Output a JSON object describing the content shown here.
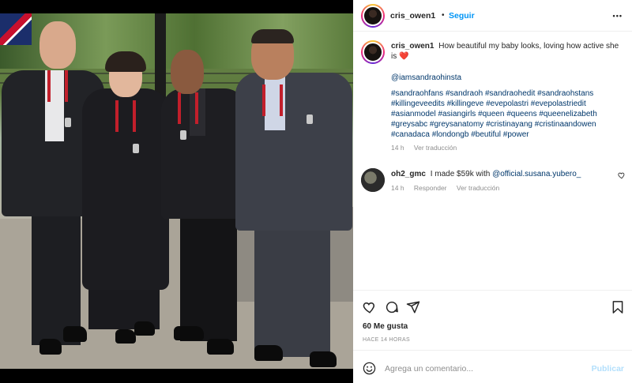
{
  "post": {
    "author": "cris_owen1",
    "separator": "•",
    "follow_label": "Seguir",
    "more_label": "•••"
  },
  "caption": {
    "author": "cris_owen1",
    "text": "How beautiful my baby looks, loving how active she is",
    "emoji": "❤️",
    "mention": "@iamsandraohinsta",
    "hashtags": "#sandraohfans #sandraoh #sandraohedit #sandraohstans #killingeveedits #killingeve #evepolastri #evepolastriedit #asianmodel #asiangirls #queen #queens #queenelizabeth #greysabc #greysanatomy #cristinayang #cristinaandowen #canadaca #londongb #beutiful #power",
    "time": "14 h",
    "translate_label": "Ver traducción"
  },
  "comment": {
    "author": "oh2_gmc",
    "text": "I made $59k with",
    "mention": "@official.susana.yubero_",
    "time": "14 h",
    "reply_label": "Responder",
    "translate_label": "Ver traducción"
  },
  "actions": {
    "likes": "60 Me gusta",
    "posted_ago": "HACE 14 HORAS"
  },
  "add_comment": {
    "placeholder": "Agrega un comentario...",
    "publish_label": "Publicar"
  },
  "colors": {
    "link": "#00376b",
    "follow": "#0095f6",
    "publish_disabled": "#b2dffc",
    "muted": "#8e8e8e"
  }
}
